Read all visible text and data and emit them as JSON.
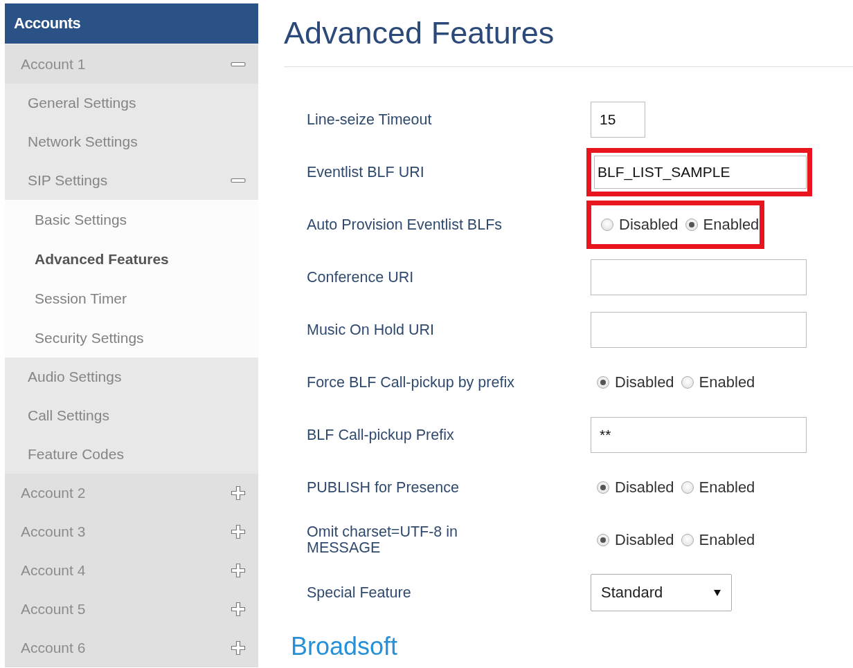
{
  "sidebar": {
    "header": "Accounts",
    "items": [
      {
        "label": "Account 1",
        "expanded": true,
        "selected": false,
        "children": [
          {
            "label": "General Settings",
            "selected": false
          },
          {
            "label": "Network Settings",
            "selected": false
          },
          {
            "label": "SIP Settings",
            "expanded": true,
            "selected": false,
            "children": [
              {
                "label": "Basic Settings",
                "selected": false
              },
              {
                "label": "Advanced Features",
                "selected": true
              },
              {
                "label": "Session Timer",
                "selected": false
              },
              {
                "label": "Security Settings",
                "selected": false
              }
            ]
          },
          {
            "label": "Audio Settings",
            "selected": false
          },
          {
            "label": "Call Settings",
            "selected": false
          },
          {
            "label": "Feature Codes",
            "selected": false
          }
        ]
      },
      {
        "label": "Account 2",
        "expanded": false,
        "selected": false
      },
      {
        "label": "Account 3",
        "expanded": false,
        "selected": false
      },
      {
        "label": "Account 4",
        "expanded": false,
        "selected": false
      },
      {
        "label": "Account 5",
        "expanded": false,
        "selected": false
      },
      {
        "label": "Account 6",
        "expanded": false,
        "selected": false
      }
    ]
  },
  "page": {
    "title": "Advanced Features",
    "rows": [
      {
        "kind": "number",
        "label": "Line-seize Timeout",
        "value": "15",
        "highlighted": false
      },
      {
        "kind": "text",
        "label": "Eventlist BLF URI",
        "value": "BLF_LIST_SAMPLE",
        "highlighted": true
      },
      {
        "kind": "radio",
        "label": "Auto Provision Eventlist BLFs",
        "options": [
          {
            "label": "Disabled",
            "selected": false
          },
          {
            "label": "Enabled",
            "selected": true
          }
        ],
        "highlighted": true
      },
      {
        "kind": "text",
        "label": "Conference URI",
        "highlighted": false
      },
      {
        "kind": "text",
        "label": "Music On Hold URI",
        "highlighted": false
      },
      {
        "kind": "radio",
        "label": "Force BLF Call-pickup by prefix",
        "options": [
          {
            "label": "Disabled",
            "selected": true
          },
          {
            "label": "Enabled",
            "selected": false
          }
        ],
        "highlighted": false
      },
      {
        "kind": "text",
        "label": "BLF Call-pickup Prefix",
        "value": "**",
        "highlighted": false
      },
      {
        "kind": "radio",
        "label": "PUBLISH for Presence",
        "options": [
          {
            "label": "Disabled",
            "selected": true
          },
          {
            "label": "Enabled",
            "selected": false
          }
        ],
        "highlighted": false
      },
      {
        "kind": "radio",
        "label": "Omit charset=UTF-8 in\nMESSAGE",
        "options": [
          {
            "label": "Disabled",
            "selected": true
          },
          {
            "label": "Enabled",
            "selected": false
          }
        ],
        "highlighted": false
      },
      {
        "kind": "select",
        "label": "Special Feature",
        "value": "Standard",
        "highlighted": false
      }
    ],
    "section": "Broadsoft"
  }
}
